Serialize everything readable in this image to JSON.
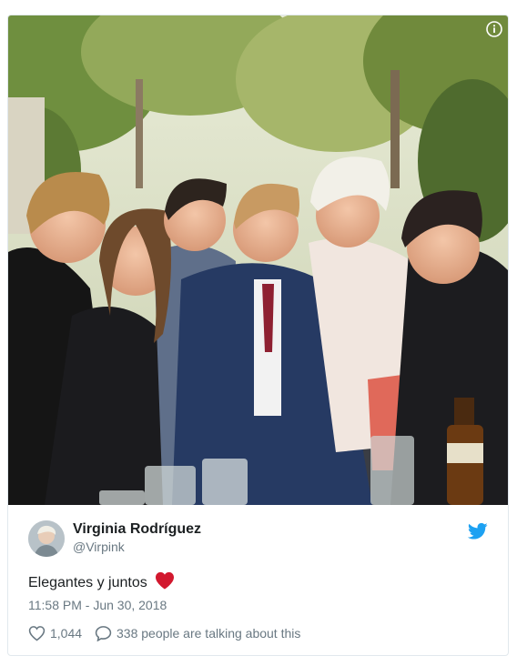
{
  "author": {
    "name": "Virginia Rodríguez",
    "handle": "@Virpink"
  },
  "tweet": {
    "text": "Elegantes y juntos",
    "emoji": "red-heart",
    "timestamp": "11:58 PM - Jun 30, 2018"
  },
  "actions": {
    "likes": "1,044",
    "replies": "338 people are talking about this"
  },
  "icons": {
    "info": "info-icon",
    "platform": "twitter-bird-icon",
    "like": "heart-outline-icon",
    "reply": "speech-bubble-icon"
  },
  "colors": {
    "brand": "#1da1f2",
    "heart": "#e0245e",
    "text_primary": "#1c2022",
    "text_secondary": "#697882"
  }
}
